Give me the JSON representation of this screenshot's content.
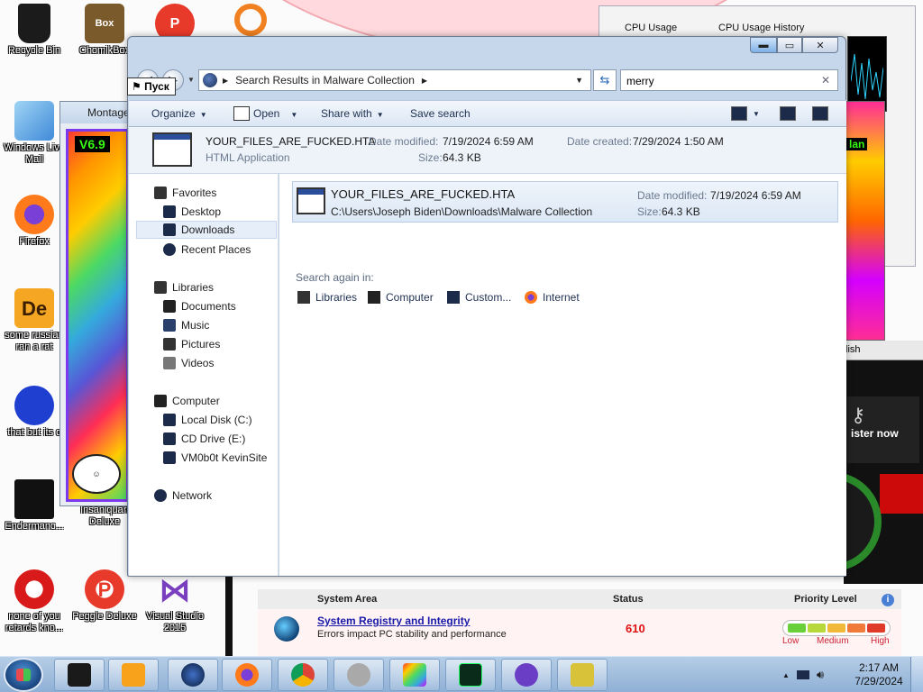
{
  "desktop_icons": [
    {
      "label": "Recycle Bin",
      "icon": "recycle-bin-icon",
      "color": "#222222"
    },
    {
      "label": "ChomikBox",
      "icon": "chomikbox-icon",
      "color": "#7a5a2a"
    },
    {
      "label": "Windows Live Mail",
      "icon": "mail-icon",
      "color": "#4a8ad8"
    },
    {
      "label": "Firefox",
      "icon": "firefox-icon",
      "color": "#ff7a1a"
    },
    {
      "label": "some russian ran a rat",
      "icon": "de-icon",
      "color": "#f5a623"
    },
    {
      "label": "that but its c",
      "icon": "pixel-face-icon",
      "color": "#1f3fd0"
    },
    {
      "label": "Endermanc...",
      "icon": "enderman-icon",
      "color": "#111111"
    },
    {
      "label": "Insaniquari Deluxe",
      "icon": "insaniquarium-icon",
      "color": "#ff4a2a"
    },
    {
      "label": "none of you retards kno...",
      "icon": "red-creature-icon",
      "color": "#d81a1a"
    },
    {
      "label": "Peggle Deluxe",
      "icon": "peggle-icon",
      "color": "#e83a2a"
    },
    {
      "label": "Visual Studio 2015",
      "icon": "visual-studio-icon",
      "color": "#7a3fbf"
    }
  ],
  "task_manager": {
    "cpu_usage": "CPU Usage",
    "cpu_history": "CPU Usage History"
  },
  "montage": {
    "title": "Montage",
    "version": "V6.9"
  },
  "right_strip_label": "lan",
  "pusk_label": "Пуск",
  "registry_panel": {
    "menu": "lish",
    "register": "ister now"
  },
  "system_area": {
    "headers": {
      "area": "System Area",
      "status": "Status",
      "priority": "Priority Level"
    },
    "row": {
      "link": "System Registry and Integrity",
      "desc": "Errors impact PC stability and performance",
      "status": "610"
    },
    "priority_labels": {
      "low": "Low",
      "medium": "Medium",
      "high": "High"
    },
    "priority_colors": [
      "#6ad03a",
      "#b6d83a",
      "#f0b93a",
      "#f07a3a",
      "#e03a2a"
    ]
  },
  "explorer": {
    "address": "Search Results in Malware Collection",
    "search_value": "merry",
    "toolbar": {
      "organize": "Organize",
      "open": "Open",
      "share_with": "Share with",
      "save_search": "Save search"
    },
    "info": {
      "filename": "YOUR_FILES_ARE_FUCKED.HTA",
      "type": "HTML Application",
      "date_modified_label": "Date modified:",
      "date_modified": "7/19/2024 6:59 AM",
      "date_created_label": "Date created:",
      "date_created": "7/29/2024 1:50 AM",
      "size_label": "Size:",
      "size": "64.3 KB"
    },
    "nav": {
      "favorites": "Favorites",
      "desktop": "Desktop",
      "downloads": "Downloads",
      "recent": "Recent Places",
      "libraries": "Libraries",
      "documents": "Documents",
      "music": "Music",
      "pictures": "Pictures",
      "videos": "Videos",
      "computer": "Computer",
      "local_disk": "Local Disk (C:)",
      "cd_drive": "CD Drive (E:)",
      "vm": "VM0b0t KevinSite",
      "network": "Network"
    },
    "result": {
      "filename": "YOUR_FILES_ARE_FUCKED.HTA",
      "path": "C:\\Users\\Joseph Biden\\Downloads\\Malware Collection",
      "date_modified_label": "Date modified:",
      "date_modified": "7/19/2024 6:59 AM",
      "size_label": "Size:",
      "size": "64.3 KB"
    },
    "search_again": {
      "label": "Search again in:",
      "libraries": "Libraries",
      "computer": "Computer",
      "custom": "Custom...",
      "internet": "Internet"
    }
  },
  "taskbar": {
    "time": "2:17 AM",
    "date": "7/29/2024"
  }
}
